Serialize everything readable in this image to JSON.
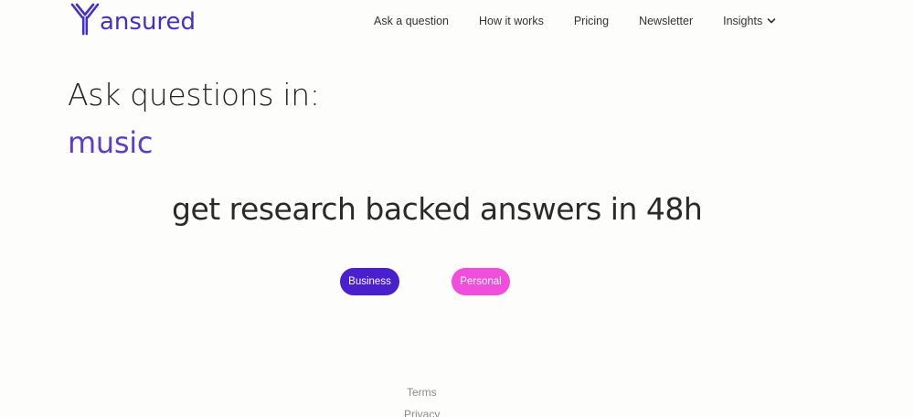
{
  "header": {
    "brand": "ansured",
    "logo_icon": "antibody-y-icon",
    "brand_color": "#4430c9",
    "nav": {
      "ask": "Ask a question",
      "how": "How it works",
      "pricing": "Pricing",
      "newsletter": "Newsletter",
      "insights": "Insights"
    }
  },
  "hero": {
    "headline": "Ask questions in:",
    "topic": "music",
    "topic_color": "#5b3fc8",
    "subheadline": "get research backed answers in 48h"
  },
  "actions": {
    "business_label": "Business",
    "business_color": "#4a1fce",
    "personal_label": "Personal",
    "personal_color": "#ef4fdc"
  },
  "footer": {
    "terms": "Terms",
    "privacy": "Privacy"
  }
}
